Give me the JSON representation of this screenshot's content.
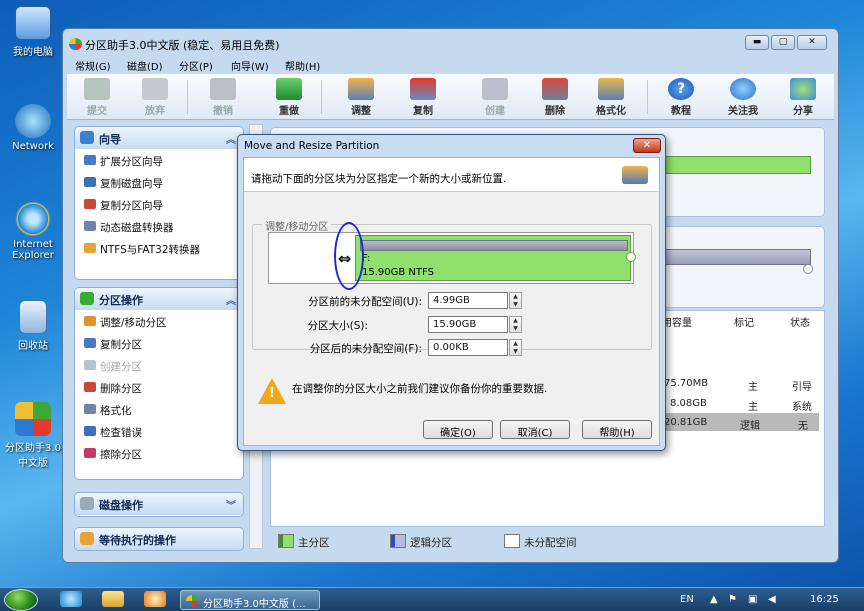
{
  "desktop": {
    "icons": [
      {
        "label": "我的电脑",
        "icon": "computer-icon"
      },
      {
        "label": "Network",
        "icon": "network-icon"
      },
      {
        "label": "Internet Explorer",
        "icon": "ie-icon"
      },
      {
        "label": "回收站",
        "icon": "recycle-bin-icon"
      },
      {
        "label": "分区助手3.0中文版",
        "icon": "partition-assistant-icon"
      }
    ]
  },
  "taskbar": {
    "task_label": "分区助手3.0中文版 (...",
    "lang": "EN",
    "time": "16:25"
  },
  "window": {
    "title": "分区助手3.0中文版 (稳定、易用且免费)",
    "menus": [
      "常规(G)",
      "磁盘(D)",
      "分区(P)",
      "向导(W)",
      "帮助(H)"
    ],
    "toolbar": [
      {
        "label": "提交",
        "enabled": false,
        "icon": "check-icon"
      },
      {
        "label": "放弃",
        "enabled": false,
        "icon": "discard-icon"
      },
      {
        "label": "撤销",
        "enabled": false,
        "icon": "undo-icon"
      },
      {
        "label": "重做",
        "enabled": true,
        "icon": "redo-icon"
      },
      {
        "label": "调整",
        "enabled": true,
        "icon": "resize-icon"
      },
      {
        "label": "复制",
        "enabled": true,
        "icon": "copy-icon"
      },
      {
        "label": "创建",
        "enabled": false,
        "icon": "create-icon"
      },
      {
        "label": "删除",
        "enabled": true,
        "icon": "delete-icon"
      },
      {
        "label": "格式化",
        "enabled": true,
        "icon": "format-icon"
      },
      {
        "label": "教程",
        "enabled": true,
        "icon": "help-icon"
      },
      {
        "label": "关注我",
        "enabled": true,
        "icon": "follow-icon"
      },
      {
        "label": "分享",
        "enabled": true,
        "icon": "share-icon"
      }
    ]
  },
  "sidebar": {
    "wizard": {
      "title": "向导",
      "items": [
        "扩展分区向导",
        "复制磁盘向导",
        "复制分区向导",
        "动态磁盘转换器",
        "NTFS与FAT32转换器"
      ]
    },
    "partition_ops": {
      "title": "分区操作",
      "items": [
        {
          "label": "调整/移动分区",
          "enabled": true
        },
        {
          "label": "复制分区",
          "enabled": true
        },
        {
          "label": "创建分区",
          "enabled": false
        },
        {
          "label": "删除分区",
          "enabled": true
        },
        {
          "label": "格式化",
          "enabled": true
        },
        {
          "label": "检查错误",
          "enabled": true
        },
        {
          "label": "擦除分区",
          "enabled": true
        }
      ]
    },
    "disk_ops": {
      "title": "磁盘操作"
    },
    "pending": {
      "title": "等待执行的操作"
    }
  },
  "table": {
    "headers": [
      "用容量",
      "标记",
      "状态"
    ],
    "rows": [
      {
        "capacity": "75.70MB",
        "flag": "主",
        "status": "引导"
      },
      {
        "capacity": "8.08GB",
        "flag": "主",
        "status": "系统"
      },
      {
        "capacity": "20.81GB",
        "flag": "逻辑",
        "status": "无"
      }
    ]
  },
  "legend": {
    "primary": "主分区",
    "logical": "逻辑分区",
    "unallocated": "未分配空间"
  },
  "dialog": {
    "title": "Move and Resize Partition",
    "instruction": "请拖动下面的分区块为分区指定一个新的大小或新位置.",
    "group_label": "调整/移动分区",
    "partition_drive": "F:",
    "partition_info": "15.90GB NTFS",
    "fields": {
      "before_label": "分区前的未分配空间(U):",
      "before_value": "4.99GB",
      "size_label": "分区大小(S):",
      "size_value": "15.90GB",
      "after_label": "分区后的未分配空间(F):",
      "after_value": "0.00KB"
    },
    "warning": "在调整你的分区大小之前我们建议你备份你的重要数据.",
    "buttons": {
      "ok": "确定(O)",
      "cancel": "取消(C)",
      "help": "帮助(H)"
    }
  }
}
